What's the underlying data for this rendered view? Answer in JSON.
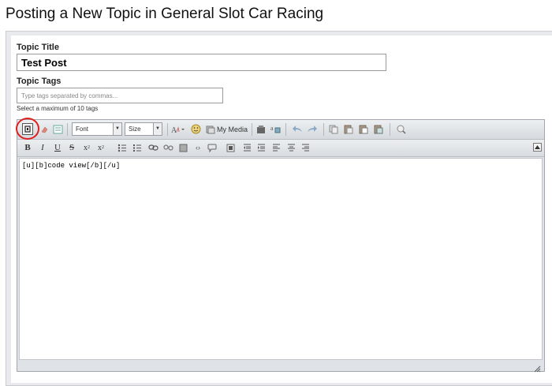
{
  "page": {
    "title": "Posting a New Topic in General Slot Car Racing"
  },
  "form": {
    "topic_title_label": "Topic Title",
    "topic_title_value": "Test Post",
    "topic_tags_label": "Topic Tags",
    "tags_placeholder": "Type tags separated by commas...",
    "tags_hint": "Select a maximum of 10 tags"
  },
  "editor": {
    "font_select": "Font",
    "size_select": "Size",
    "my_media_label": "My Media",
    "content": "[u][b]code view[/b][/u]",
    "format_buttons": {
      "bold": "B",
      "italic": "I",
      "underline": "U",
      "strike": "S",
      "subscript": "x",
      "superscript": "x"
    }
  },
  "colors": {
    "highlight_circle": "#e01e1e",
    "toolbar_bg": "#dfe2e6"
  }
}
